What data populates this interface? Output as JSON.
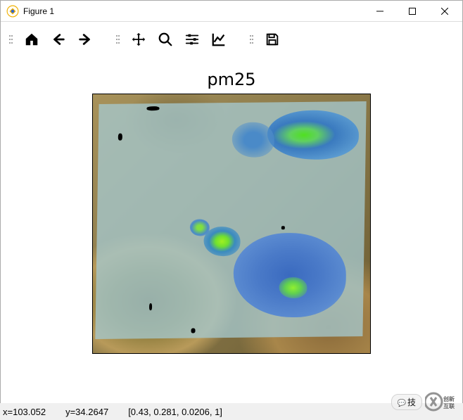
{
  "window": {
    "title": "Figure 1"
  },
  "toolbar": {
    "home": "Home",
    "back": "Back",
    "forward": "Forward",
    "pan": "Pan",
    "zoom": "Zoom",
    "configure": "Configure subplots",
    "edit": "Edit axis",
    "save": "Save"
  },
  "chart_data": {
    "type": "heatmap",
    "title": "pm25",
    "xlabel": "",
    "ylabel": "",
    "x_range_approx": [
      96,
      110
    ],
    "y_range_approx": [
      28,
      40
    ],
    "colormap": "terrain+overlay",
    "overlay_opacity_approx": 0.78,
    "cursor_sample": {
      "x": 103.052,
      "y": 34.2647,
      "rgba": [
        0.43,
        0.281,
        0.0206,
        1
      ]
    },
    "note": "Geographic raster overlay (PM2.5) on a terrain basemap; no axis ticks or colorbar visible; numeric grid values are not readable from the figure aside from the cursor readout."
  },
  "status": {
    "x_label": "x=103.052",
    "y_label": "y=34.2647",
    "pixel": "[0.43, 0.281, 0.0206, 1]"
  },
  "watermark": {
    "bubble": "技",
    "logo": "创新互联"
  }
}
